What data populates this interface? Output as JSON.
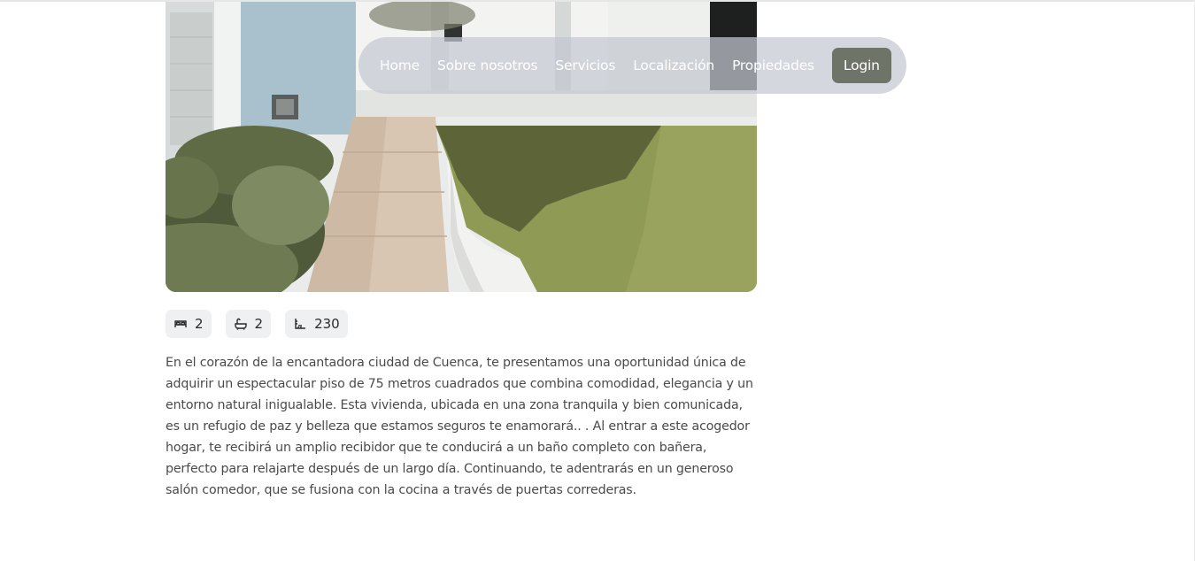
{
  "nav": {
    "links": [
      "Home",
      "Sobre nosotros",
      "Servicios",
      "Localización",
      "Propiedades"
    ],
    "login_label": "Login"
  },
  "property": {
    "features": [
      {
        "icon": "bed-icon",
        "value": "2"
      },
      {
        "icon": "bathtub-icon",
        "value": "2"
      },
      {
        "icon": "area-icon",
        "value": "230"
      }
    ],
    "description": "En el corazón de la encantadora ciudad de Cuenca, te presentamos una oportunidad única de adquirir un espectacular piso de 75 metros cuadrados que combina comodidad, elegancia y un entorno natural inigualable. Esta vivienda, ubicada en una zona tranquila y bien comunicada, es un refugio de paz y belleza que estamos seguros te enamorará.. . Al entrar a este acogedor hogar, te recibirá un amplio recibidor que te conducirá a un baño completo con bañera, perfecto para relajarte después de un largo día. Continuando, te adentrarás en un generoso salón comedor, que se fusiona con la cocina a través de puertas correderas."
  },
  "colors": {
    "nav_bg": "#c4c8d0",
    "login_bg": "#6e7468",
    "feature_bg": "#eef0f2"
  }
}
